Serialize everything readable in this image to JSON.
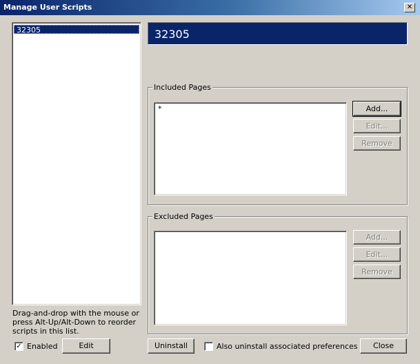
{
  "window": {
    "title": "Manage User Scripts",
    "close_symbol": "✕"
  },
  "scripts_list": {
    "items": [
      "32305"
    ],
    "selected_index": 0
  },
  "script_header": {
    "name": "32305"
  },
  "included_pages": {
    "label": "Included Pages",
    "items": [
      "*"
    ],
    "add_label": "Add...",
    "edit_label": "Edit...",
    "remove_label": "Remove"
  },
  "excluded_pages": {
    "label": "Excluded Pages",
    "items": [],
    "add_label": "Add...",
    "edit_label": "Edit...",
    "remove_label": "Remove"
  },
  "hint": {
    "line1": "Drag-and-drop with the mouse or",
    "line2": "press Alt-Up/Alt-Down to reorder",
    "line3": "scripts in this list."
  },
  "enabled": {
    "label": "Enabled",
    "checked": true,
    "mark": "✓"
  },
  "edit_button": "Edit",
  "uninstall_button": "Uninstall",
  "also_uninstall": {
    "label": "Also uninstall associated preferences",
    "checked": false
  },
  "close_button": "Close",
  "colors": {
    "header_bg": "#0a246a",
    "dialog_bg": "#d4d0c8"
  }
}
